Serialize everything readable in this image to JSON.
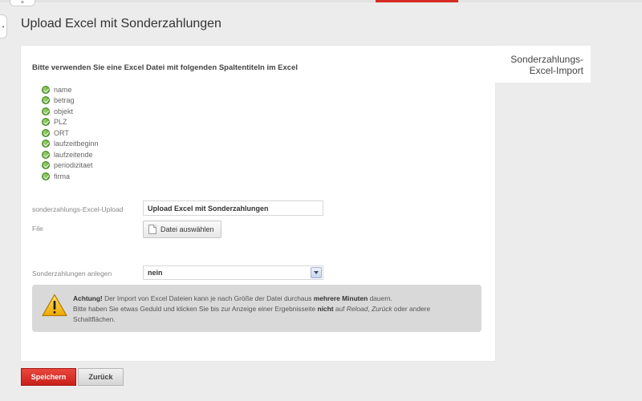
{
  "header": {
    "top_tab_glyph": "+",
    "side_handle_glyph": "•",
    "page_title": "Upload Excel mit Sonderzahlungen",
    "accent_color": "#d62b22"
  },
  "side_tab": {
    "line1": "Sonderzahlungs-",
    "line2": "Excel-Import"
  },
  "form": {
    "intro": "Bitte verwenden Sie eine Excel Datei mit folgenden Spaltentiteln im Excel",
    "columns": [
      "name",
      "betrag",
      "objekt",
      "PLZ",
      "ORT",
      "laufzeitbeginn",
      "laufzeitende",
      "periodizitaet",
      "firma"
    ],
    "upload_label": "sonderzahlungs-Excel-Upload",
    "upload_value": "Upload Excel mit Sonderzahlungen",
    "file_label": "File",
    "file_button": "Datei auswählen",
    "create_label": "Sonderzahlungen anlegen",
    "create_value": "nein"
  },
  "warning": {
    "icon": "warning-triangle-icon",
    "achtung": "Achtung!",
    "text1": " Der Import von Excel Dateien kann je nach Größe der Datei durchaus ",
    "strong1": "mehrere Minuten",
    "text2": " dauern.",
    "text3": "Bitte haben Sie etwas Geduld und klicken Sie bis zur Anzeige einer Ergebnisseite ",
    "strong2": "nicht",
    "text4": " auf ",
    "em1": "Reload",
    "text5": ", ",
    "em2": "Zurück",
    "text6": " oder andere Schaltflächen."
  },
  "buttons": {
    "save": "Speichern",
    "back": "Zurück",
    "save_color": "#d62b22"
  }
}
